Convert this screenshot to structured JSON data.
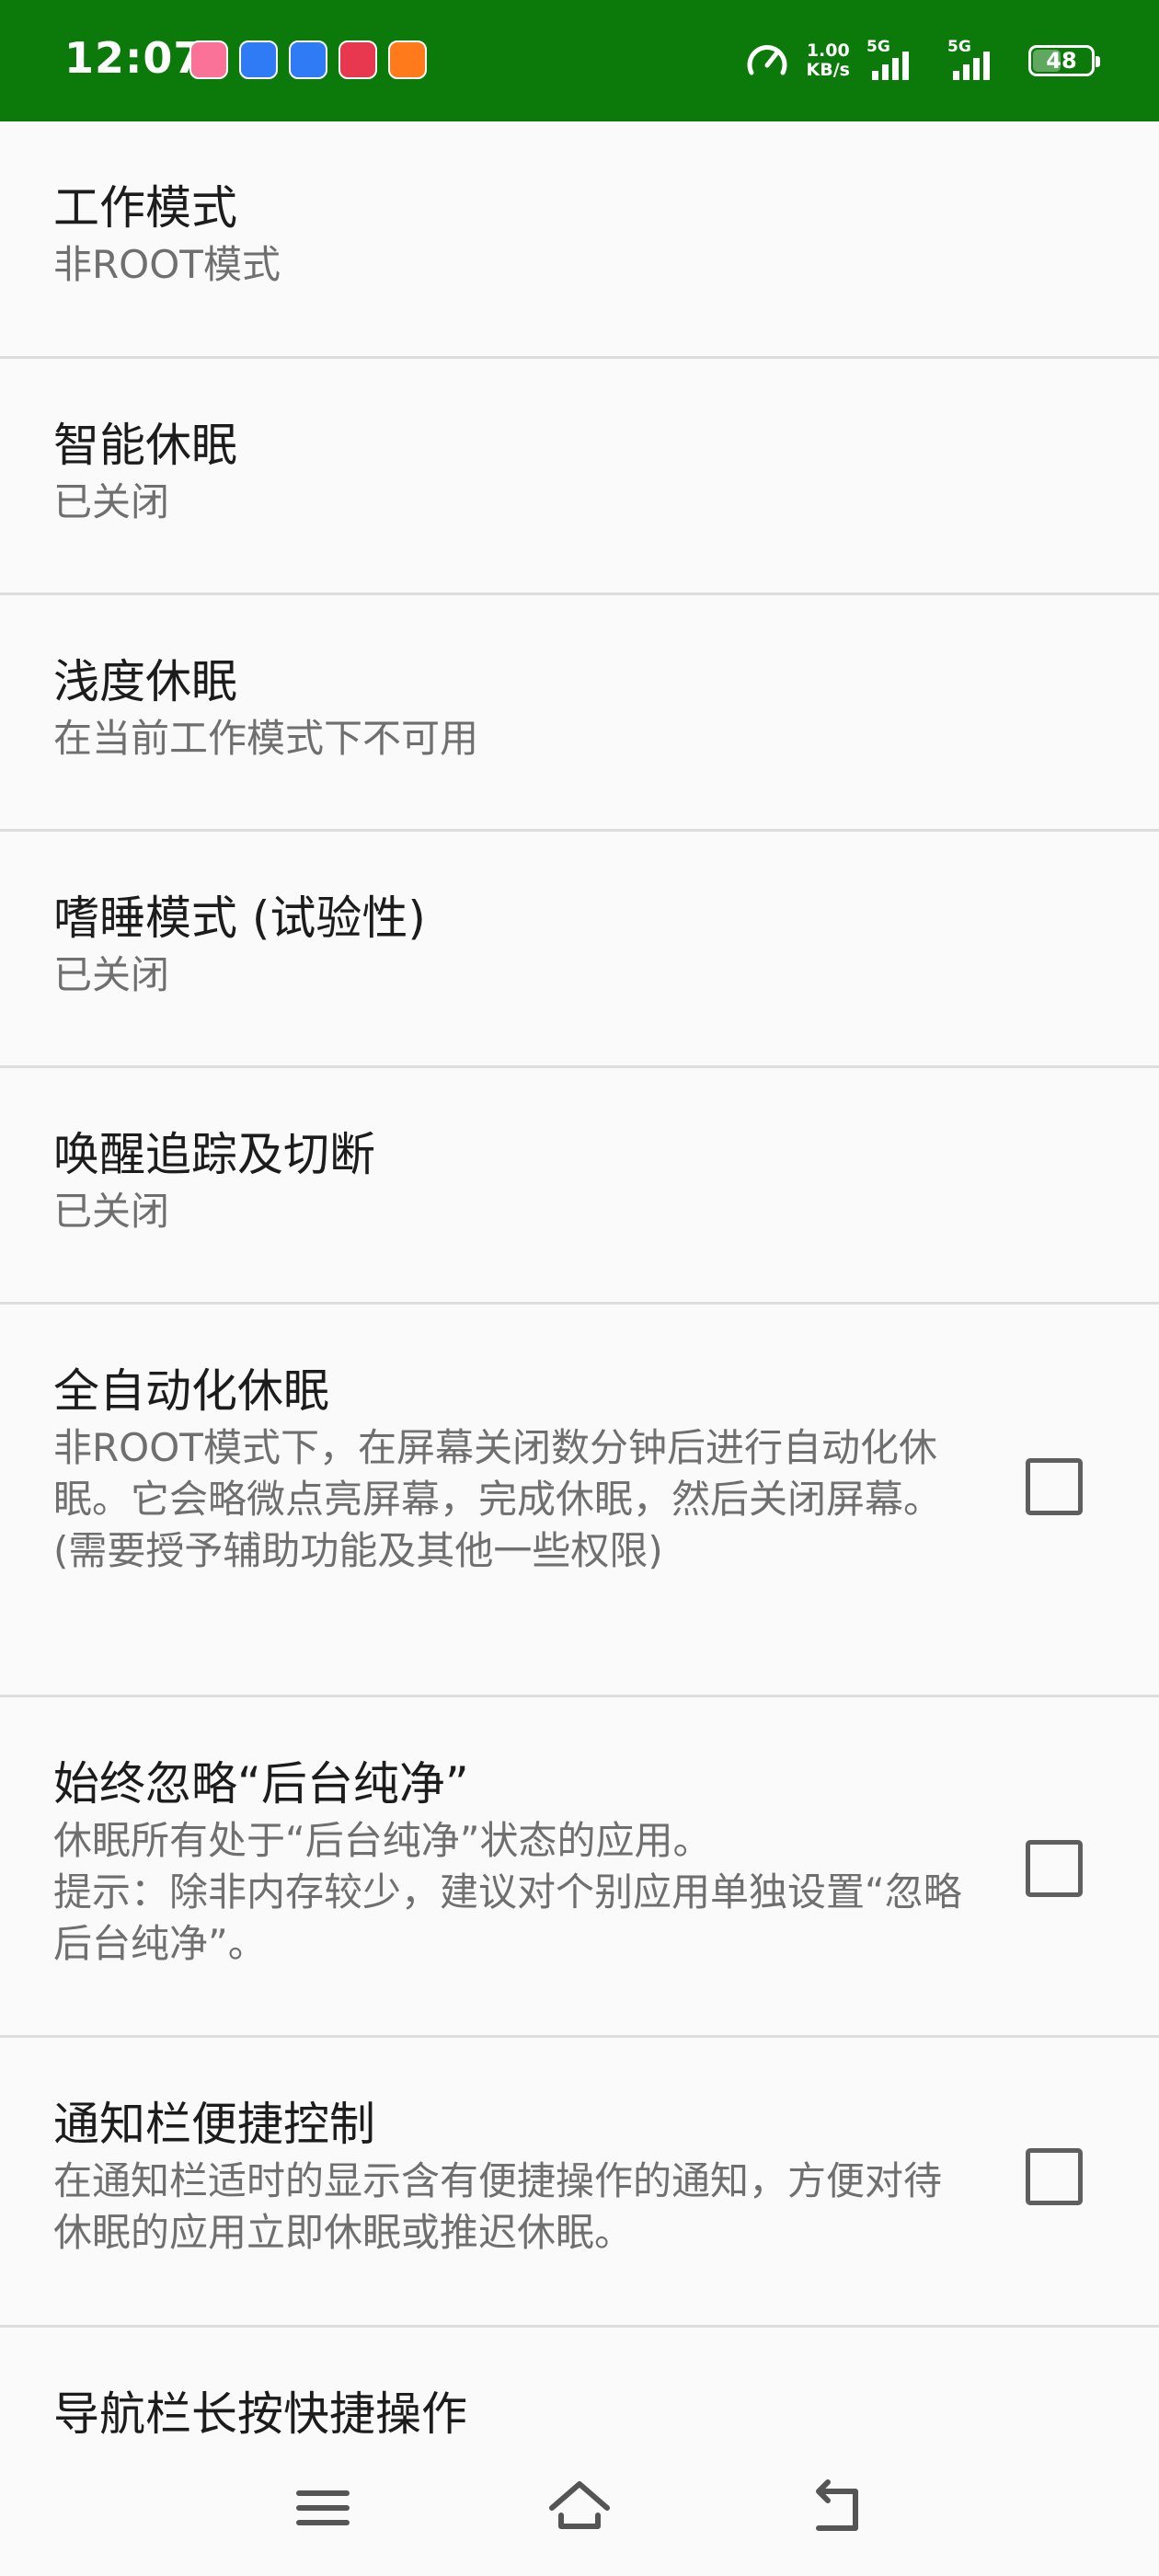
{
  "status_bar": {
    "time": "12:07",
    "net_speed_value": "1.00",
    "net_speed_unit": "KB/s",
    "sim1_label": "5G",
    "sim2_label": "5G",
    "battery_level": "48",
    "notification_apps": [
      {
        "name": "bilibili-app-icon",
        "color": "#fb7299"
      },
      {
        "name": "baidu-netdisk-icon-1",
        "color": "#2f7bf5"
      },
      {
        "name": "baidu-netdisk-icon-2",
        "color": "#2f7bf5"
      },
      {
        "name": "cartoon-app-icon",
        "color": "#e8384f"
      },
      {
        "name": "orange-app-icon",
        "color": "#ff7a1a"
      }
    ]
  },
  "settings": [
    {
      "title": "工作模式",
      "subtitle": "非ROOT模式",
      "has_checkbox": false
    },
    {
      "title": "智能休眠",
      "subtitle": "已关闭",
      "has_checkbox": false
    },
    {
      "title": "浅度休眠",
      "subtitle": "在当前工作模式下不可用",
      "has_checkbox": false
    },
    {
      "title": "嗜睡模式 (试验性)",
      "subtitle": "已关闭",
      "has_checkbox": false
    },
    {
      "title": "唤醒追踪及切断",
      "subtitle": "已关闭",
      "has_checkbox": false
    },
    {
      "title": "全自动化休眠",
      "subtitle": "非ROOT模式下，在屏幕关闭数分钟后进行自动化休眠。它会略微点亮屏幕，完成休眠，然后关闭屏幕。(需要授予辅助功能及其他一些权限)",
      "has_checkbox": true,
      "checked": false
    },
    {
      "title": "始终忽略“后台纯净”",
      "subtitle": "休眠所有处于“后台纯净”状态的应用。\n提示：除非内存较少，建议对个别应用单独设置“忽略后台纯净”。",
      "has_checkbox": true,
      "checked": false
    },
    {
      "title": "通知栏便捷控制",
      "subtitle": "在通知栏适时的显示含有便捷操作的通知，方便对待休眠的应用立即休眠或推迟休眠。",
      "has_checkbox": true,
      "checked": false
    },
    {
      "title": "导航栏长按快捷操作",
      "subtitle": "",
      "has_checkbox": false
    }
  ],
  "colors": {
    "status_bar_bg": "#0b7a0b",
    "title_text": "#1c1c1c",
    "subtitle_text": "#6f6f6f",
    "divider": "#dddddd"
  }
}
